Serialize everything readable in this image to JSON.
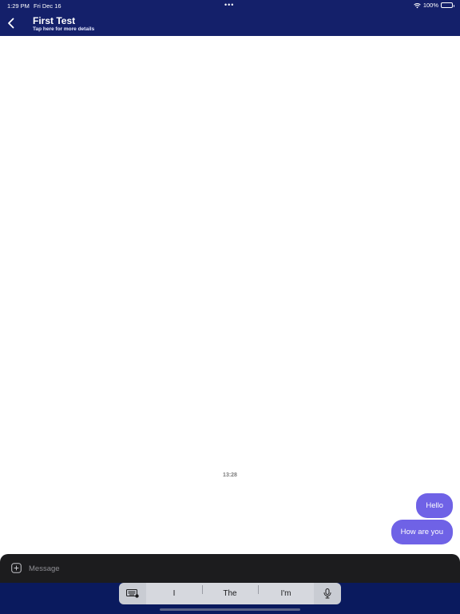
{
  "status": {
    "time": "1:29 PM",
    "date": "Fri Dec 16",
    "dots": "•••",
    "battery": "100%"
  },
  "header": {
    "title": "First Test",
    "subtitle": "Tap here for more details"
  },
  "chat": {
    "timestamp": "13:28",
    "messages": [
      {
        "text": "Hello"
      },
      {
        "text": "How are you"
      }
    ]
  },
  "composer": {
    "placeholder": "Message"
  },
  "keyboard": {
    "suggestions": [
      "I",
      "The",
      "I'm"
    ]
  },
  "colors": {
    "header_bg": "#14206a",
    "bubble": "#6f62e6",
    "composer_bg": "#1c1c1e"
  }
}
